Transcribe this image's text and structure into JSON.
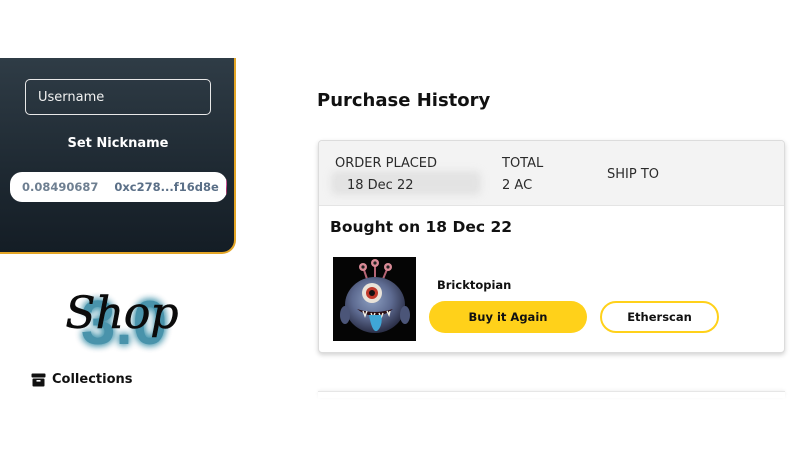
{
  "profile": {
    "username_placeholder": "Username",
    "set_nickname_label": "Set Nickname",
    "wallet": {
      "balance": "0.08490687",
      "address": "0xc278...f16d8e",
      "avatar_color": "#b5317a"
    }
  },
  "logo": {
    "script_text": "Shop",
    "number_text": "3.0",
    "glow_color": "#21d4ff"
  },
  "nav": {
    "collections_label": "Collections",
    "collections_icon": "box-icon"
  },
  "main": {
    "title": "Purchase History",
    "order": {
      "order_placed_label": "ORDER PLACED",
      "order_placed_value": "18 Dec 22",
      "total_label": "TOTAL",
      "total_value": "2 AC",
      "ship_to_label": "SHIP TO",
      "bought_on": "Bought on 18 Dec 22",
      "product": {
        "name": "Bricktopian",
        "image_icon": "monster-nft-image"
      },
      "buy_again_label": "Buy it Again",
      "etherscan_label": "Etherscan"
    }
  },
  "colors": {
    "accent_yellow": "#ffd11a",
    "panel_border": "#e3a526",
    "panel_dark": "#1f2a33"
  }
}
